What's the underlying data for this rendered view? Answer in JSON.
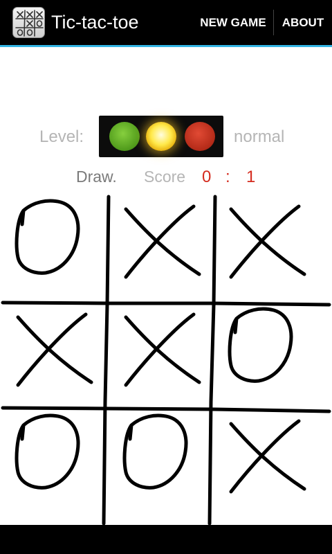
{
  "action_bar": {
    "title": "Tic-tac-toe",
    "icon": "tic-tac-toe-app-icon",
    "buttons": {
      "new_game": "NEW GAME",
      "about": "ABOUT"
    },
    "accent_color": "#33b5e5"
  },
  "level": {
    "label": "Level:",
    "value": "normal",
    "indicator": "traffic-light-icon",
    "active_lamp": "yellow"
  },
  "status": {
    "text": "Draw.",
    "score_label": "Score",
    "score_left": "0",
    "score_separator": ":",
    "score_right": "1",
    "score_color": "#d42b1e"
  },
  "board": {
    "cells": [
      "O",
      "X",
      "X",
      "X",
      "X",
      "O",
      "O",
      "O",
      "X"
    ]
  }
}
